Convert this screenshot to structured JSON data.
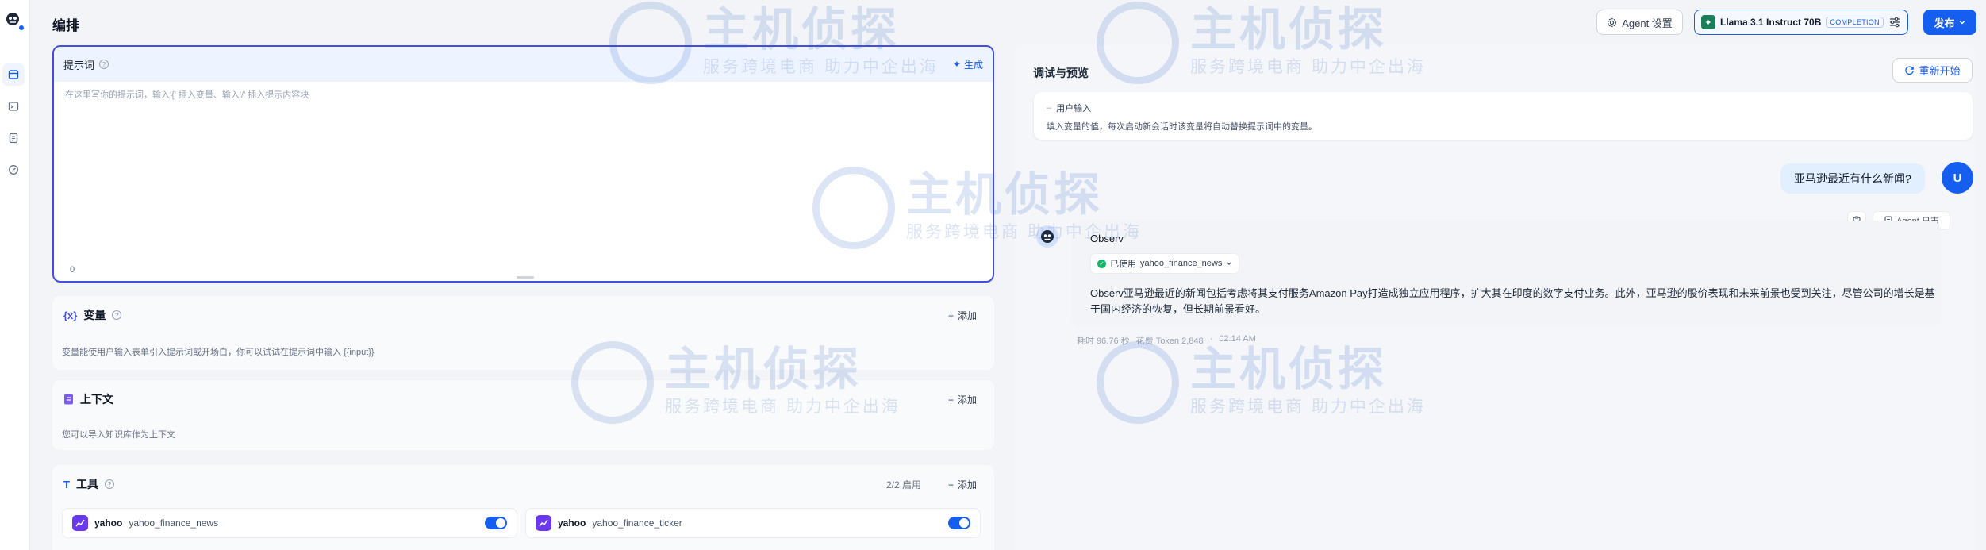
{
  "header": {
    "title": "编排",
    "agent_settings_label": "Agent 设置",
    "model_name": "Llama 3.1 Instruct 70B",
    "model_mode": "COMPLETION",
    "publish_label": "发布"
  },
  "prompt": {
    "title": "提示词",
    "generate_label": "生成",
    "placeholder": "在这里写你的提示词，输入'{' 插入变量、输入'/' 插入提示内容块",
    "char_count": "0"
  },
  "variables": {
    "title": "变量",
    "add_label": "添加",
    "description": "变量能使用户输入表单引入提示词或开场白，你可以试试在提示词中输入 {{input}}"
  },
  "context": {
    "title": "上下文",
    "add_label": "添加",
    "description": "您可以导入知识库作为上下文"
  },
  "tools": {
    "title": "工具",
    "enabled_count": "2/2 启用",
    "add_label": "添加",
    "items": [
      {
        "provider": "yahoo",
        "name": "yahoo_finance_news"
      },
      {
        "provider": "yahoo",
        "name": "yahoo_finance_ticker"
      }
    ]
  },
  "debug": {
    "title": "调试与预览",
    "restart_label": "重新开始",
    "user_input_title": "用户输入",
    "user_input_desc": "填入变量的值，每次启动新会话时该变量将自动替换提示词中的变量。",
    "user_message": "亚马逊最近有什么新闻?",
    "user_avatar_initial": "U",
    "copy_label": "",
    "agent_log_label": "Agent 日志",
    "bot_name": "Observ",
    "used_tool_prefix": "已使用",
    "used_tool_name": "yahoo_finance_news",
    "answer": "Observ亚马逊最近的新闻包括考虑将其支付服务Amazon Pay打造成独立应用程序，扩大其在印度的数字支付业务。此外，亚马逊的股价表现和未来前景也受到关注，尽管公司的增长是基于国内经济的恢复，但长期前景看好。",
    "meta_time": "耗时 96.76 秒",
    "meta_tokens": "花费 Token 2,848",
    "meta_clock": "02:14 AM"
  },
  "watermark": {
    "brand": "主机侦探",
    "slogan": "服务跨境电商 助力中企出海"
  },
  "colors": {
    "accent": "#155eef",
    "prompt_border": "#444ce7",
    "tool_icon": "#6938ef",
    "success": "#12b76a"
  },
  "icons": [
    "app-logo-icon",
    "orchestrate-icon",
    "terminal-icon",
    "logs-icon",
    "monitor-icon",
    "gear-icon",
    "model-icon",
    "sliders-icon",
    "chevron-down-icon",
    "info-icon",
    "sparkle-icon",
    "variable-icon",
    "document-icon",
    "tool-icon",
    "plus-icon",
    "refresh-icon",
    "clipboard-icon",
    "log-icon",
    "check-circle-icon"
  ]
}
